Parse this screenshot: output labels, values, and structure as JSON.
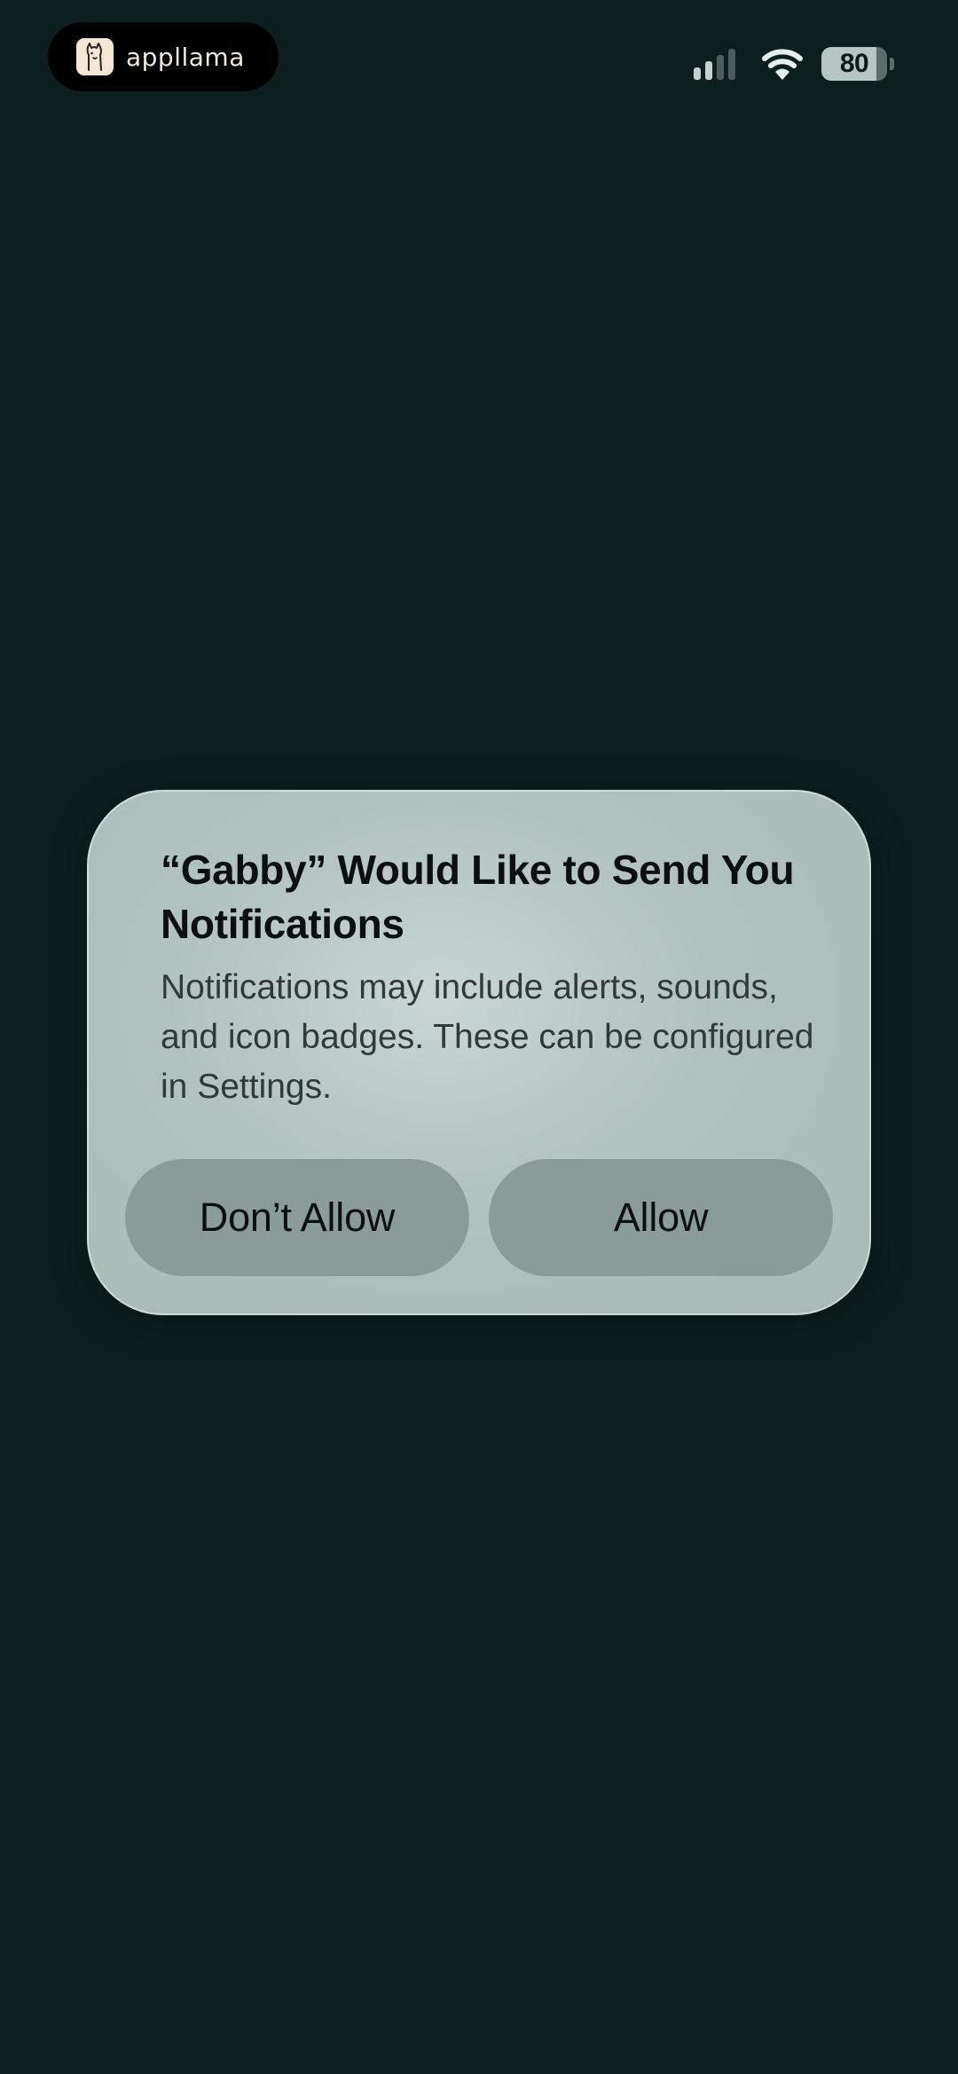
{
  "status_bar": {
    "app_badge_name": "appllama",
    "app_badge_icon": "llama-logo-icon",
    "battery_level": "80",
    "signal_bars_active": 2,
    "signal_bars_total": 4,
    "icons": [
      "cellular-signal-icon",
      "wifi-icon",
      "battery-icon"
    ]
  },
  "dialog": {
    "title": "“Gabby” Would Like to Send You Notifications",
    "message": "Notifications may include alerts, sounds, and icon badges. These can be configured in Settings.",
    "buttons": {
      "dont_allow_label": "Don’t Allow",
      "allow_label": "Allow"
    }
  },
  "colors": {
    "background": "#0d1e1e",
    "dialog_background": "#b2c2bf",
    "button_background": "#8a9b99",
    "title_text": "#0b0f0f",
    "message_text": "#2f3a39",
    "pill_background": "#000000"
  }
}
